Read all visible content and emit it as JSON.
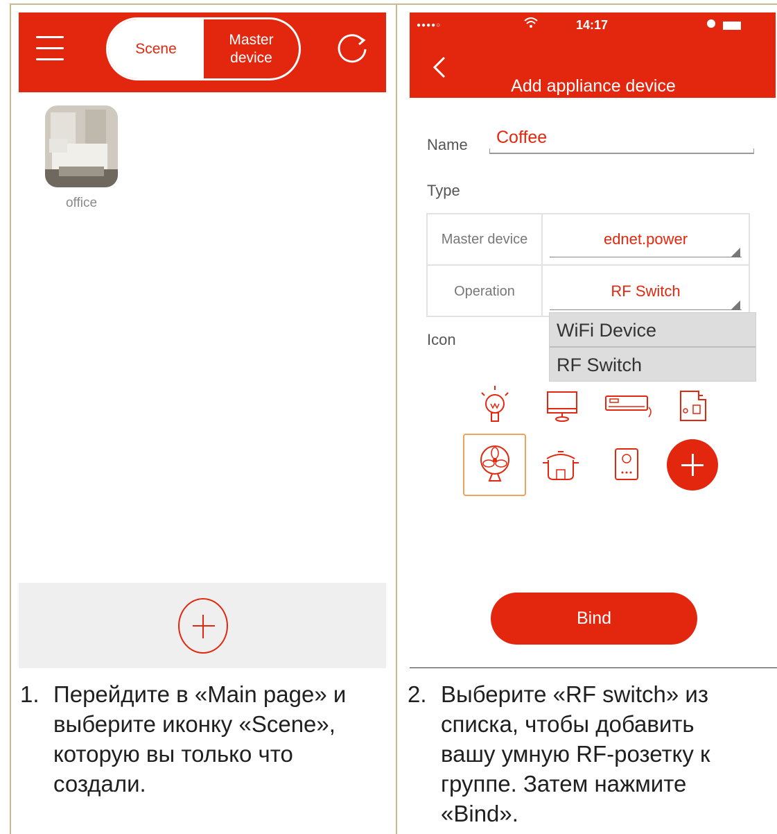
{
  "left": {
    "header": {
      "tab_scene": "Scene",
      "tab_master": "Master\ndevice",
      "menu_icon": "hamburger-icon",
      "refresh_icon": "refresh-icon"
    },
    "scenes": [
      {
        "label": "office",
        "icon": "bedroom-photo"
      }
    ],
    "add_icon": "add-icon"
  },
  "right": {
    "status": {
      "signal": "●●●●○",
      "time": "14:17",
      "wifi_icon": "wifi-icon",
      "alarm_icon": "alarm-icon",
      "battery_icon": "battery-icon"
    },
    "title": "Add appliance device",
    "form": {
      "name_label": "Name",
      "name_value": "Coffee",
      "type_label": "Type",
      "master_label": "Master device",
      "master_value": "ednet.power",
      "operation_label": "Operation",
      "operation_value": "RF Switch",
      "icon_label": "Icon"
    },
    "dropdown_options": [
      "WiFi Device",
      "RF Switch"
    ],
    "icons": [
      "lamp-icon",
      "monitor-icon",
      "air-conditioner-icon",
      "coffee-machine-icon",
      "fan-icon",
      "rice-cooker-icon",
      "water-heater-icon",
      "add-icon"
    ],
    "selected_icon": "fan-icon",
    "bind_label": "Bind"
  },
  "captions": {
    "step1_num": "1.",
    "step1_l1": "Перейдите в «Main page» и",
    "step1_l2": "выберите иконку «Scene»,",
    "step1_l3": "которую вы только что",
    "step1_l4": "создали.",
    "step2_num": "2.",
    "step2_l1": "Выберите «RF switch» из",
    "step2_l2": "списка, чтобы добавить",
    "step2_l3": "вашу умную RF-розетку к",
    "step2_l4": "группе. Затем нажмите",
    "step2_l5": "«Bind»."
  },
  "colors": {
    "brand_red": "#e3270f",
    "selected_border": "#f0a15a"
  }
}
